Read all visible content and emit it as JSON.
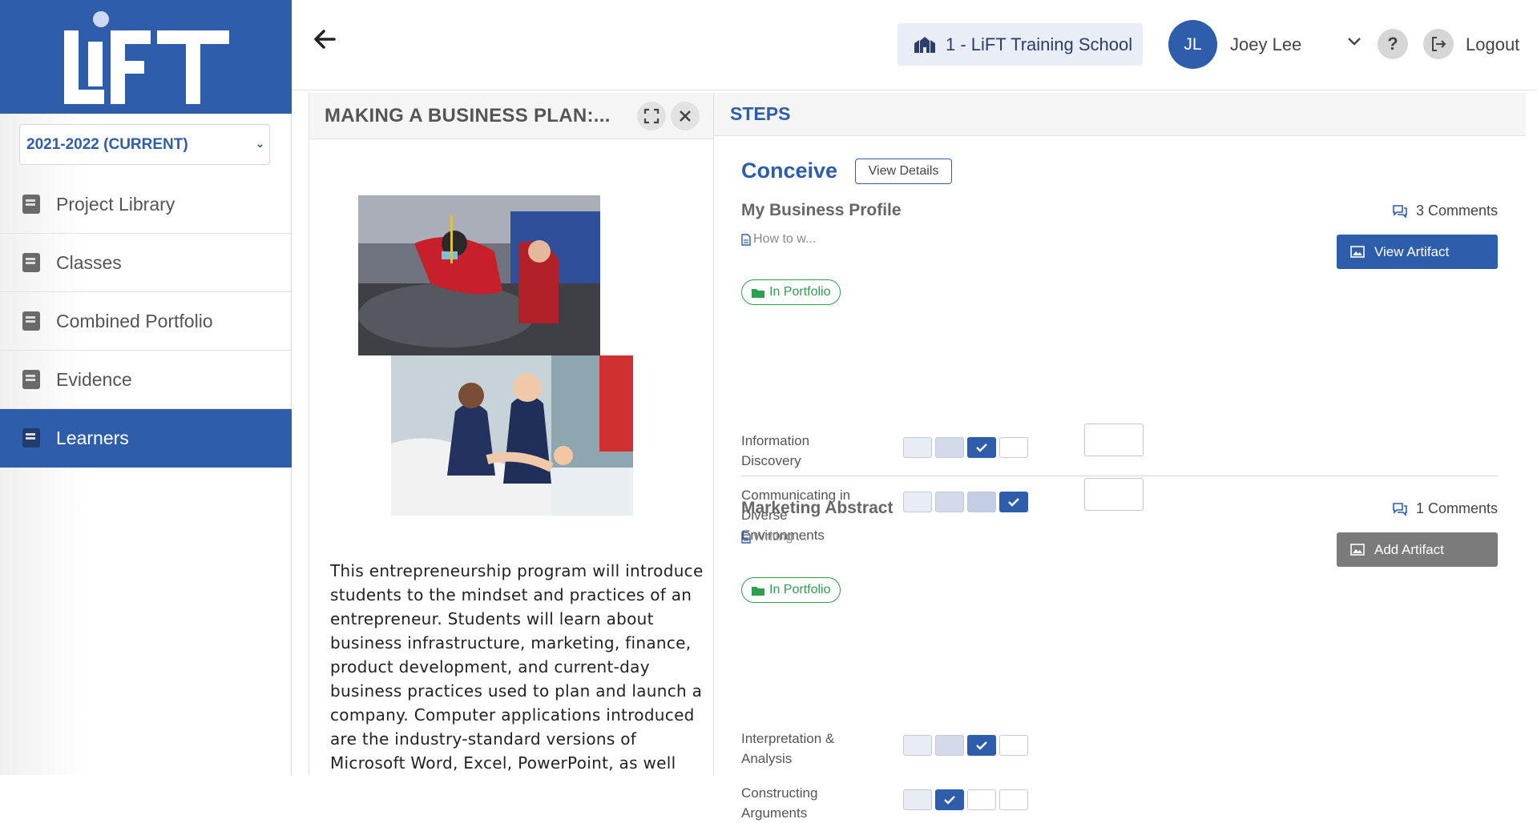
{
  "sidebar": {
    "logo_text": "LiFT",
    "year_select": "2021-2022 (CURRENT)",
    "items": [
      {
        "label": "Project Library",
        "active": false
      },
      {
        "label": "Classes",
        "active": false
      },
      {
        "label": "Combined Portfolio",
        "active": false
      },
      {
        "label": "Evidence",
        "active": false
      },
      {
        "label": "Learners",
        "active": true
      }
    ]
  },
  "header": {
    "school": "1 - LiFT Training School",
    "avatar_initials": "JL",
    "user_name": "Joey Lee",
    "help_label": "?",
    "logout_label": "Logout"
  },
  "project": {
    "title": "MAKING A BUSINESS PLAN:...",
    "description": "This entrepreneurship program will introduce students to the mindset and  practices of an entrepreneur. Students will learn about business  infrastructure, marketing, finance, product development, and current-day business practices used to plan and launch a company. Computer  applications introduced are the industry-standard versions of Microsoft  Word, Excel, PowerPoint, as well"
  },
  "steps": {
    "heading": "STEPS",
    "phase": "Conceive",
    "view_details_label": "View Details",
    "items": [
      {
        "name": "My Business Profile",
        "comments": "3 Comments",
        "doc": "How to w...",
        "artifact_label": "View Artifact",
        "portfolio_label": "In Portfolio",
        "skills": [
          {
            "name": "Information Discovery",
            "level": 3
          },
          {
            "name": "Communicating in Diverse Environments",
            "level": 4
          }
        ]
      },
      {
        "name": "Marketing Abstract",
        "comments": "1 Comments",
        "doc": "Writing ...",
        "artifact_label": "Add Artifact",
        "portfolio_label": "In Portfolio",
        "skills": [
          {
            "name": "Interpretation & Analysis",
            "level": 3
          },
          {
            "name": "Constructing Arguments",
            "level": 2
          }
        ]
      }
    ]
  },
  "colors": {
    "brand_blue": "#2d5dab",
    "portfolio_green": "#2e9e4f",
    "add_grey": "#7b7b7b"
  },
  "icons": [
    "back-arrow-icon",
    "school-icon",
    "chevron-down-icon",
    "help-icon",
    "logout-icon",
    "expand-icon",
    "close-icon",
    "comments-icon",
    "document-icon",
    "image-icon",
    "folder-icon",
    "check-icon",
    "book-icon"
  ]
}
